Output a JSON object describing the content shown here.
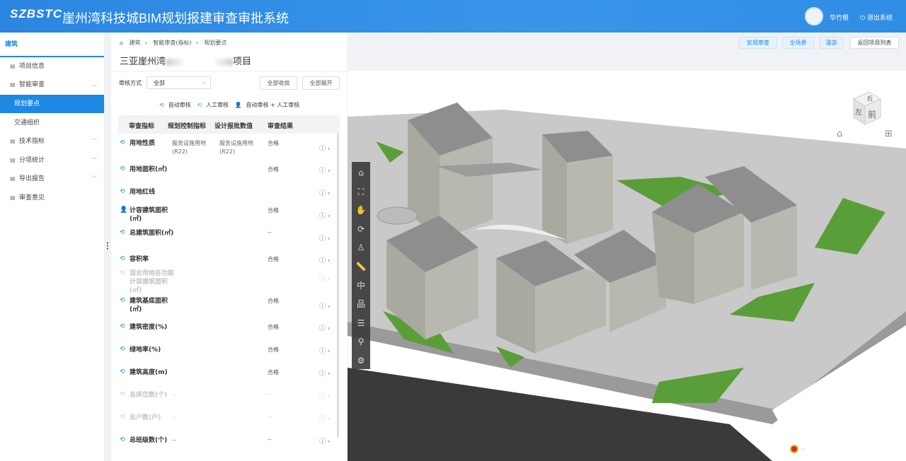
{
  "header": {
    "logo": "SZBSTC",
    "title": "崖州湾科技城BIM规划报建审查审批系统",
    "user": "华竹根",
    "logout": "退出系统"
  },
  "sidebar": {
    "head": "建筑",
    "items": [
      {
        "label": "项目信息",
        "icon": "document-icon"
      },
      {
        "label": "智能审查",
        "icon": "review-icon",
        "chevron": "^"
      },
      {
        "label": "规划要点",
        "sub": true,
        "active": true
      },
      {
        "label": "交通组织",
        "sub": true
      },
      {
        "label": "技术指标",
        "icon": "building-icon",
        "chevron": "v"
      },
      {
        "label": "分项统计",
        "icon": "stats-icon",
        "chevron": "v"
      },
      {
        "label": "导出报告",
        "icon": "export-icon",
        "chevron": "v"
      },
      {
        "label": "审查意见",
        "icon": "opinion-icon"
      }
    ]
  },
  "breadcrumb": [
    "建筑",
    "智能审查(指标)",
    "规划要点"
  ],
  "project_title_prefix": "三亚崖州湾",
  "project_title_suffix": "项目",
  "filter": {
    "label": "审核方式",
    "value": "全部",
    "collapse_all": "全部收拢",
    "expand_all": "全部展开"
  },
  "legend": {
    "auto": "自动审核",
    "manual": "人工审核",
    "both": "自动审核 + 人工审核"
  },
  "table": {
    "headers": [
      "审查指标",
      "规划控制指标",
      "设计报批数值",
      "审查结果"
    ],
    "rows": [
      {
        "name": "用地性质",
        "type": "auto",
        "control": "服务设施用地(R22)",
        "design": "服务设施用地(R22)",
        "result": "合格"
      },
      {
        "name": "用地面积(㎡)",
        "type": "auto",
        "control": "",
        "design": "",
        "result": "合格"
      },
      {
        "name": "用地红线",
        "type": "auto",
        "control": "",
        "design": "",
        "result": ""
      },
      {
        "name": "计容建筑面积(㎡)",
        "type": "both",
        "control": "",
        "design": "",
        "result": "合格"
      },
      {
        "name": "总建筑面积(㎡)",
        "type": "auto",
        "control": "",
        "design": "",
        "result": "--"
      },
      {
        "name": "容积率",
        "type": "auto",
        "control": "",
        "design": "",
        "result": "合格"
      },
      {
        "name": "混合用地各功能计容建筑面积(㎡)",
        "type": "auto",
        "dim": true,
        "control": "",
        "design": "",
        "result": ""
      },
      {
        "name": "建筑基底面积(㎡)",
        "type": "auto",
        "control": "",
        "design": "",
        "result": "合格"
      },
      {
        "name": "建筑密度(%)",
        "type": "auto",
        "control": "",
        "design": "",
        "result": "合格"
      },
      {
        "name": "绿地率(%)",
        "type": "auto",
        "control": "",
        "design": "",
        "result": "合格"
      },
      {
        "name": "建筑高度(m)",
        "type": "auto",
        "control": "",
        "design": "",
        "result": "合格"
      },
      {
        "name": "总床位数(个)",
        "type": "auto",
        "dim": true,
        "control": "--",
        "design": "",
        "result": "--"
      },
      {
        "name": "总户数(户)",
        "type": "auto",
        "dim": true,
        "control": "--",
        "design": "",
        "result": "--"
      },
      {
        "name": "总班级数(个)",
        "type": "auto",
        "control": "--",
        "design": "",
        "result": "--"
      }
    ]
  },
  "viewer": {
    "buttons": [
      "宏观审查",
      "全场景",
      "漫游",
      "返回项目列表"
    ],
    "cube": {
      "top": "后",
      "left": "左",
      "front": "前"
    },
    "tools": [
      "home-icon",
      "fit-icon",
      "pan-icon",
      "orbit-icon",
      "walk-icon",
      "measure-icon",
      "section-icon",
      "tree-icon",
      "properties-icon",
      "search-icon",
      "settings-icon"
    ]
  },
  "colors": {
    "primary": "#1e88e5",
    "auto": "#1e88e5",
    "manual": "#2bb673",
    "both": "#8a4fd8",
    "lawn": "#5a9e3a",
    "road": "#3a3a3a"
  }
}
